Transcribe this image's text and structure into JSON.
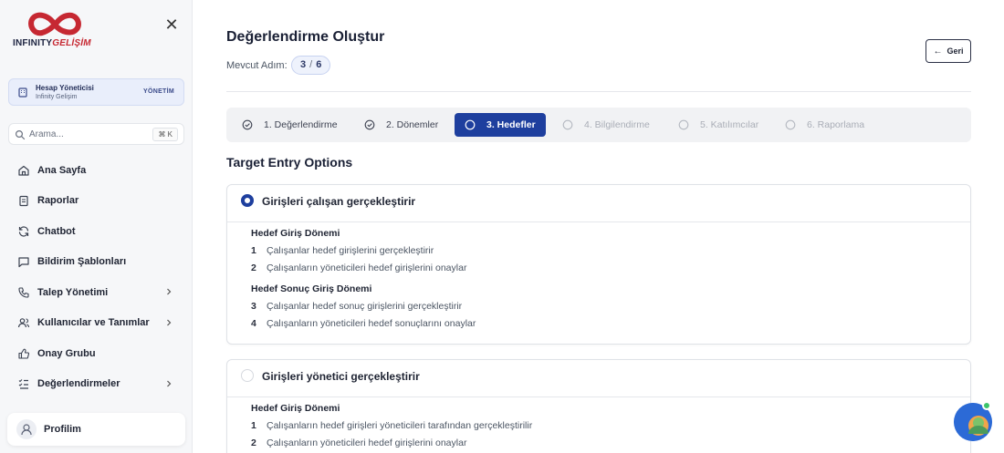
{
  "sidebar": {
    "logo": {
      "word1": "INFINITY",
      "word2": "GELİŞİM"
    },
    "account": {
      "name": "Hesap Yöneticisi",
      "org": "Infinity Gelişim",
      "badge": "YÖNETİM"
    },
    "search": {
      "placeholder": "Arama...",
      "shortcut": "⌘ K"
    },
    "items": [
      {
        "label": "Ana Sayfa",
        "icon": "home-icon",
        "chevron": false
      },
      {
        "label": "Raporlar",
        "icon": "clipboard-icon",
        "chevron": false
      },
      {
        "label": "Chatbot",
        "icon": "refresh-icon",
        "chevron": false
      },
      {
        "label": "Bildirim Şablonları",
        "icon": "message-icon",
        "chevron": false
      },
      {
        "label": "Talep Yönetimi",
        "icon": "phone-icon",
        "chevron": true
      },
      {
        "label": "Kullanıcılar ve Tanımlar",
        "icon": "users-icon",
        "chevron": true
      },
      {
        "label": "Onay Grubu",
        "icon": "thumbs-up-icon",
        "chevron": false
      },
      {
        "label": "Değerlendirmeler",
        "icon": "list-check-icon",
        "chevron": true
      }
    ],
    "profile": {
      "label": "Profilim"
    }
  },
  "header": {
    "title": "Değerlendirme Oluştur",
    "step_label": "Mevcut Adım:",
    "current_step": "3",
    "total_steps": "6",
    "back_label": "Geri"
  },
  "stepper": [
    {
      "label": "1. Değerlendirme",
      "state": "done"
    },
    {
      "label": "2. Dönemler",
      "state": "done"
    },
    {
      "label": "3. Hedefler",
      "state": "active"
    },
    {
      "label": "4. Bilgilendirme",
      "state": "todo"
    },
    {
      "label": "5. Katılımcılar",
      "state": "todo"
    },
    {
      "label": "6. Raporlama",
      "state": "todo"
    }
  ],
  "section_title": "Target Entry Options",
  "options": [
    {
      "title": "Girişleri çalışan gerçekleştirir",
      "selected": true,
      "groups": [
        {
          "title": "Hedef Giriş Dönemi",
          "rows": [
            {
              "num": "1",
              "text": "Çalışanlar hedef girişlerini gerçekleştirir"
            },
            {
              "num": "2",
              "text": "Çalışanların yöneticileri hedef girişlerini onaylar"
            }
          ]
        },
        {
          "title": "Hedef Sonuç Giriş Dönemi",
          "rows": [
            {
              "num": "3",
              "text": "Çalışanlar hedef sonuç girişlerini gerçekleştirir"
            },
            {
              "num": "4",
              "text": "Çalışanların yöneticileri hedef sonuçlarını onaylar"
            }
          ]
        }
      ]
    },
    {
      "title": "Girişleri yönetici gerçekleştirir",
      "selected": false,
      "groups": [
        {
          "title": "Hedef Giriş Dönemi",
          "rows": [
            {
              "num": "1",
              "text": "Çalışanların hedef girişleri yöneticileri tarafından gerçekleştirilir"
            },
            {
              "num": "2",
              "text": "Çalışanların yöneticileri hedef girişlerini onaylar"
            }
          ]
        }
      ]
    }
  ],
  "colors": {
    "primary": "#1e3f9e",
    "brand_red": "#c62832",
    "chat": "#2c6ad6",
    "online": "#3cc46a"
  }
}
